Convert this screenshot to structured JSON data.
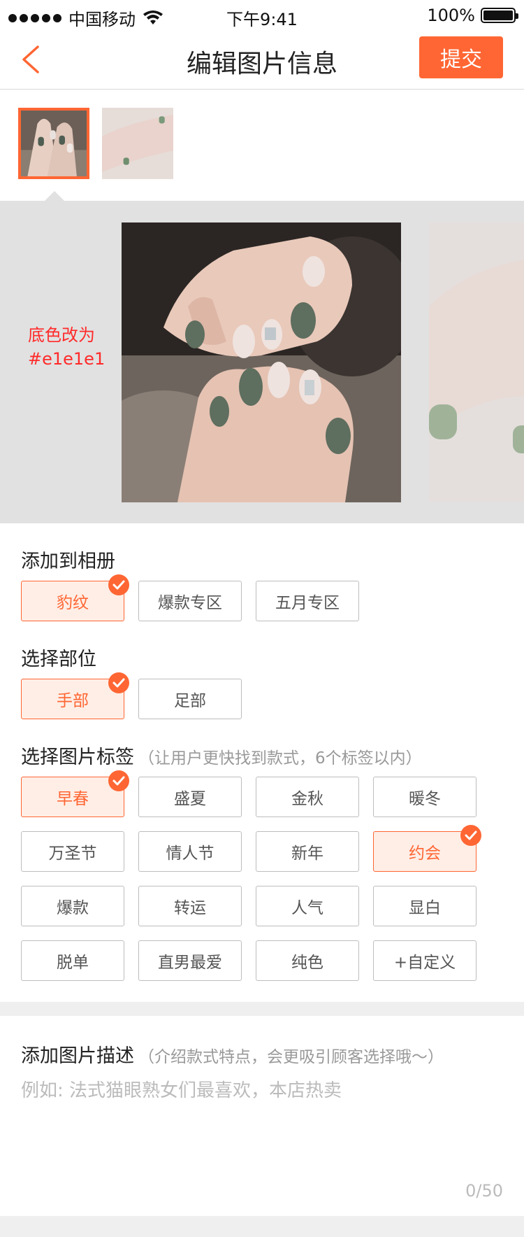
{
  "status_bar": {
    "carrier": "中国移动",
    "time": "下午9:41",
    "battery": "100%"
  },
  "nav": {
    "title": "编辑图片信息",
    "submit_label": "提交"
  },
  "preview": {
    "note": "底色改为\n#e1e1e1",
    "background_color": "#e1e1e1"
  },
  "album": {
    "title": "添加到相册",
    "options": [
      {
        "label": "豹纹",
        "selected": true
      },
      {
        "label": "爆款专区",
        "selected": false
      },
      {
        "label": "五月专区",
        "selected": false
      }
    ]
  },
  "part": {
    "title": "选择部位",
    "options": [
      {
        "label": "手部",
        "selected": true
      },
      {
        "label": "足部",
        "selected": false
      }
    ]
  },
  "tags": {
    "title": "选择图片标签",
    "hint": "（让用户更快找到款式，6个标签以内）",
    "options": [
      {
        "label": "早春",
        "selected": true
      },
      {
        "label": "盛夏",
        "selected": false
      },
      {
        "label": "金秋",
        "selected": false
      },
      {
        "label": "暖冬",
        "selected": false
      },
      {
        "label": "万圣节",
        "selected": false
      },
      {
        "label": "情人节",
        "selected": false
      },
      {
        "label": "新年",
        "selected": false
      },
      {
        "label": "约会",
        "selected": true
      },
      {
        "label": "爆款",
        "selected": false
      },
      {
        "label": "转运",
        "selected": false
      },
      {
        "label": "人气",
        "selected": false
      },
      {
        "label": "显白",
        "selected": false
      },
      {
        "label": "脱单",
        "selected": false
      },
      {
        "label": "直男最爱",
        "selected": false
      },
      {
        "label": "纯色",
        "selected": false
      },
      {
        "label": "+自定义",
        "selected": false
      }
    ]
  },
  "description": {
    "title": "添加图片描述",
    "hint": "（介绍款式特点，会更吸引顾客选择哦～）",
    "placeholder": "例如: 法式猫眼熟女们最喜欢，本店热卖",
    "counter": "0/50"
  },
  "colors": {
    "accent": "#ff6633",
    "accent_bg": "#ffeee6",
    "note": "#ff2a2a"
  }
}
